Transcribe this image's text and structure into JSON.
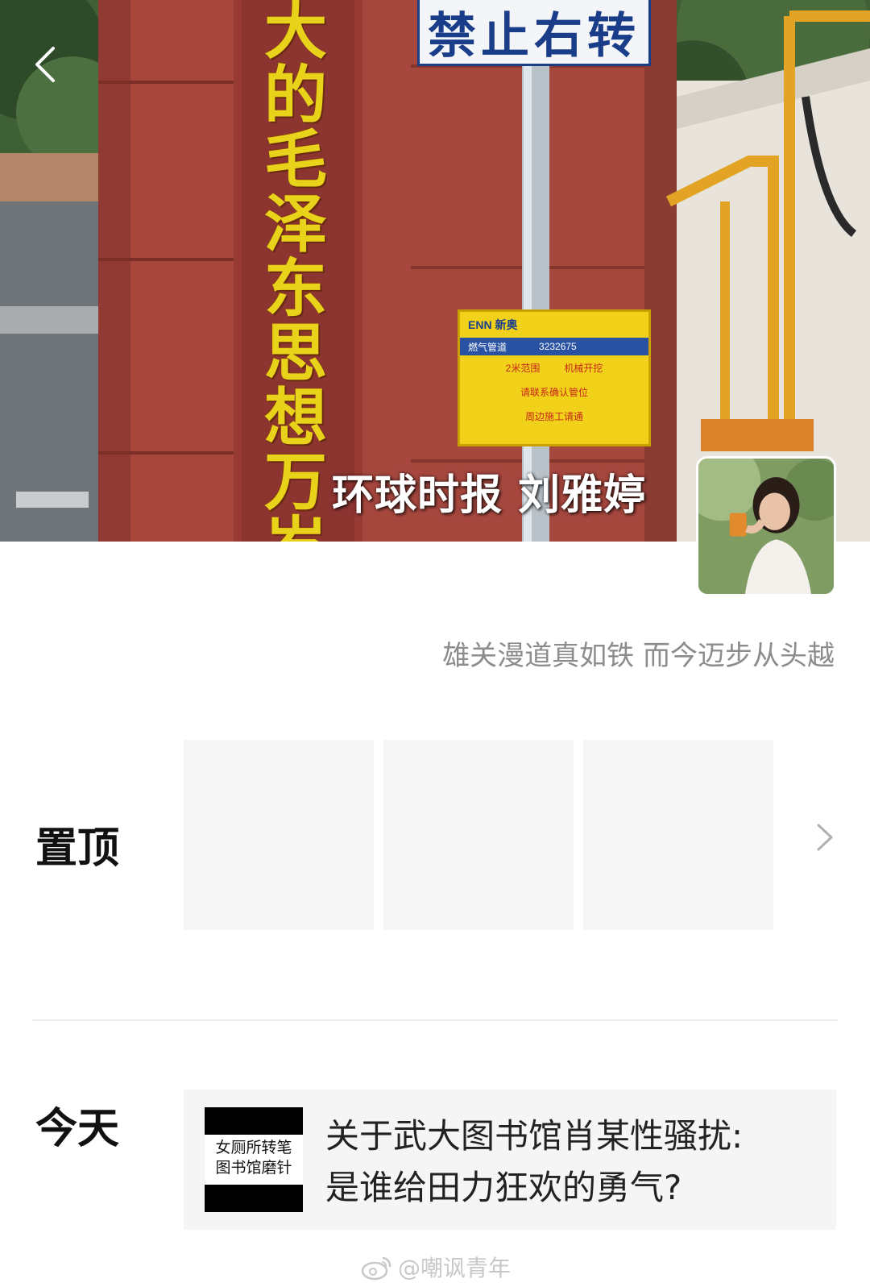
{
  "cover": {
    "gate_characters": [
      "大",
      "的",
      "毛",
      "泽",
      "东",
      "思",
      "想",
      "万",
      "岁"
    ],
    "road_sign": "禁止右转",
    "gas_label": {
      "brand": "ENN 新奥",
      "band_left": "燃气管道",
      "band_right": "3232675",
      "row1_left": "2米范围",
      "row1_right": "机械开挖",
      "row2": "请联系确认管位",
      "row3": "周边施工请通"
    },
    "overlay_text": "环球时报 刘雅婷"
  },
  "profile": {
    "signature": "雄关漫道真如铁 而今迈步从头越"
  },
  "pinned": {
    "label": "置顶",
    "tile_count": 3
  },
  "today": {
    "label": "今天",
    "post": {
      "thumbnail_line1": "女厕所转笔",
      "thumbnail_line2": "图书馆磨针",
      "title_line1": "关于武大图书馆肖某性骚扰:",
      "title_line2": "是谁给田力狂欢的勇气?"
    }
  },
  "watermark": {
    "text": "@嘲讽青年"
  },
  "icons": {
    "back": "back-arrow-icon",
    "chevron": "chevron-right-icon",
    "weibo": "weibo-logo-icon"
  },
  "colors": {
    "gate_text": "#e8d21a",
    "gate_wall": "#a1413a",
    "sign_blue": "#1a3d8a",
    "label_yellow": "#f2d11a",
    "signature_gray": "#8c8c8c",
    "tile_gray": "#f6f6f6"
  }
}
